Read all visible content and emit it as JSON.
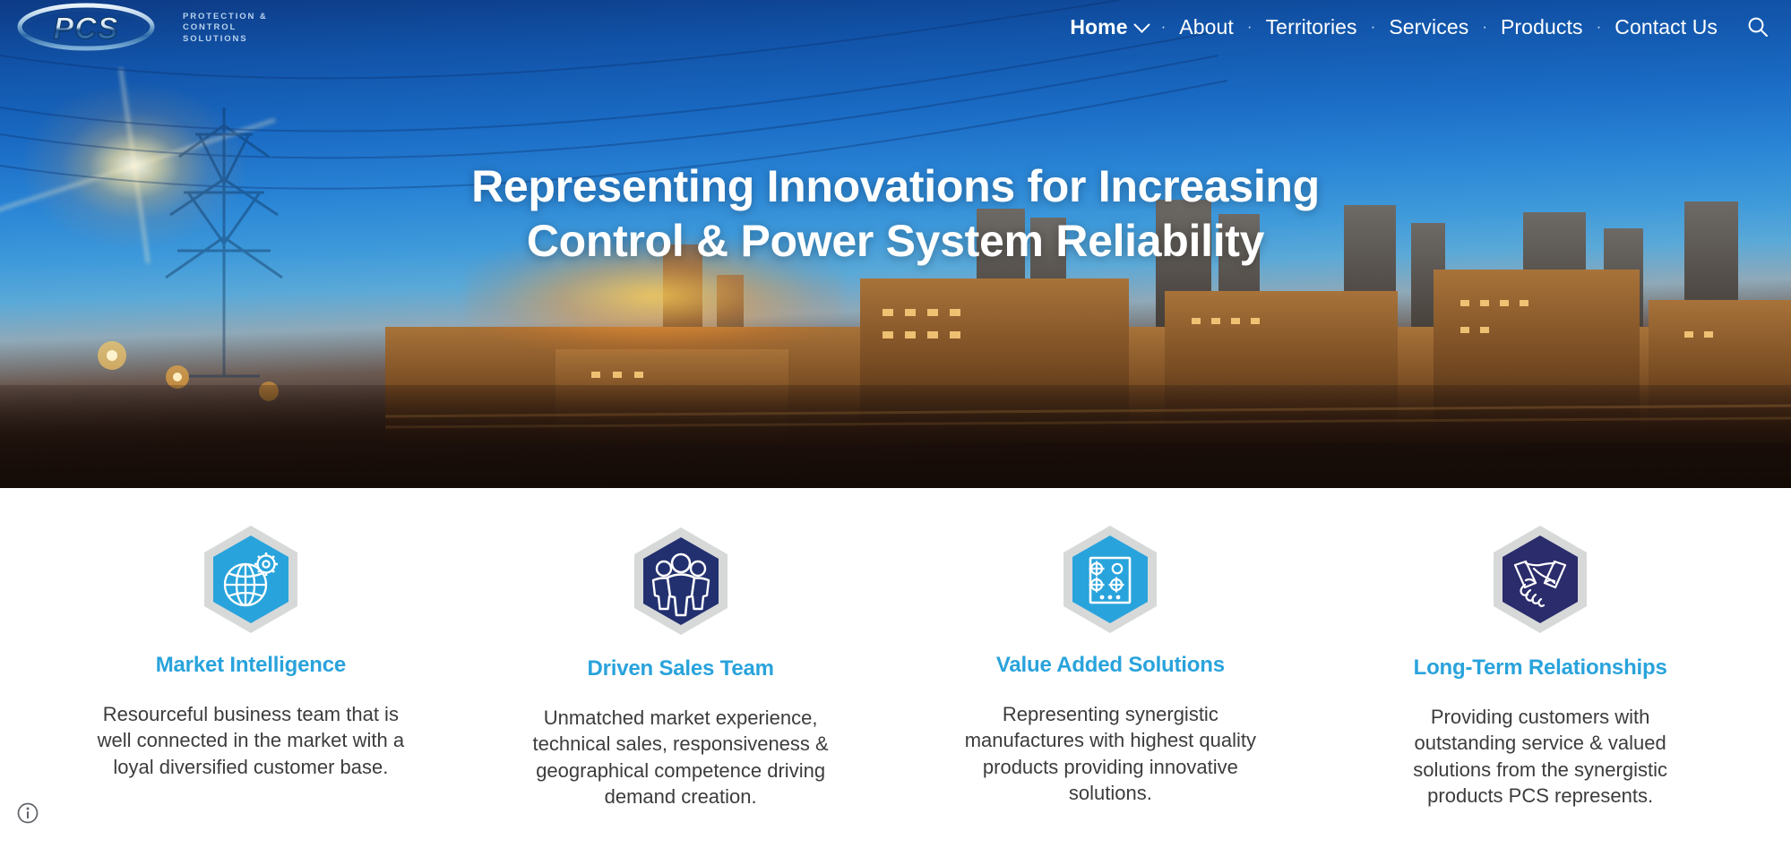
{
  "site": {
    "brand_short": "PCS",
    "brand_lines": [
      "PROTECTION &",
      "CONTROL",
      "SOLUTIONS"
    ],
    "accent_blue": "#29a3dc",
    "nav_bg_blue": "#10448f",
    "hex_navy": "#22306f",
    "hex_border_gray": "#d7d9d9"
  },
  "nav": {
    "items": [
      {
        "label": "Home",
        "active": true,
        "has_dropdown": true
      },
      {
        "label": "About",
        "active": false,
        "has_dropdown": false
      },
      {
        "label": "Territories",
        "active": false,
        "has_dropdown": false
      },
      {
        "label": "Services",
        "active": false,
        "has_dropdown": false
      },
      {
        "label": "Products",
        "active": false,
        "has_dropdown": false
      },
      {
        "label": "Contact Us",
        "active": false,
        "has_dropdown": false
      }
    ],
    "separator": "·",
    "search_icon": "search-icon"
  },
  "hero": {
    "heading_line1": "Representing Innovations for Increasing",
    "heading_line2": "Control & Power System Reliability"
  },
  "features": [
    {
      "icon": "globe-gear-icon",
      "icon_style": "blue",
      "title": "Market Intelligence",
      "body": "Resourceful business team that is well connected in the market with a loyal diversified customer base."
    },
    {
      "icon": "people-group-icon",
      "icon_style": "navy",
      "title": "Driven Sales Team",
      "body": "Unmatched market experience, technical sales, responsiveness & geographical  competence driving demand creation."
    },
    {
      "icon": "control-panel-icon",
      "icon_style": "blue",
      "title": "Value Added Solutions",
      "body": "Representing synergistic manufactures with highest quality products providing innovative solutions."
    },
    {
      "icon": "handshake-icon",
      "icon_style": "navy",
      "title": "Long-Term Relationships",
      "body": "Providing customers with outstanding service & valued solutions from the synergistic products PCS represents."
    }
  ],
  "footer_badge": {
    "icon": "info-circle-icon"
  }
}
